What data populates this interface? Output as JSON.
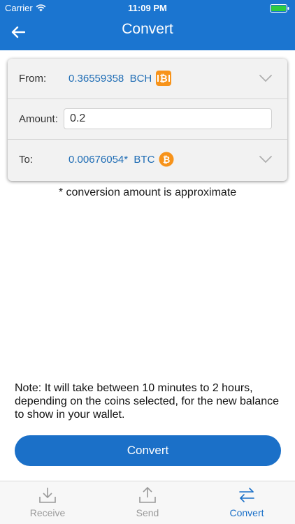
{
  "status_bar": {
    "carrier": "Carrier",
    "time": "11:09 PM"
  },
  "nav": {
    "title": "Convert",
    "back_icon": "arrow-left-icon"
  },
  "form": {
    "from_label": "From:",
    "from_value": "0.36559358  BCH",
    "from_coin_icon": "bitcoin-cash-icon",
    "amount_label": "Amount:",
    "amount_value": "0.2",
    "to_label": "To:",
    "to_value": "0.00676054*  BTC",
    "to_coin_icon": "bitcoin-icon"
  },
  "approx_note": "* conversion amount is approximate",
  "note": "Note: It will take between 10 minutes to 2 hours, depending on the coins selected, for the new balance to show in your wallet.",
  "convert_button_label": "Convert",
  "tabs": [
    {
      "label": "Receive",
      "icon": "download-tray-icon",
      "active": false
    },
    {
      "label": "Send",
      "icon": "upload-tray-icon",
      "active": false
    },
    {
      "label": "Convert",
      "icon": "swap-arrows-icon",
      "active": true
    }
  ],
  "colors": {
    "brand_blue": "#1b75d0",
    "link_blue": "#1f6db5",
    "bch_orange": "#f7931a",
    "btc_orange": "#f7931a"
  }
}
